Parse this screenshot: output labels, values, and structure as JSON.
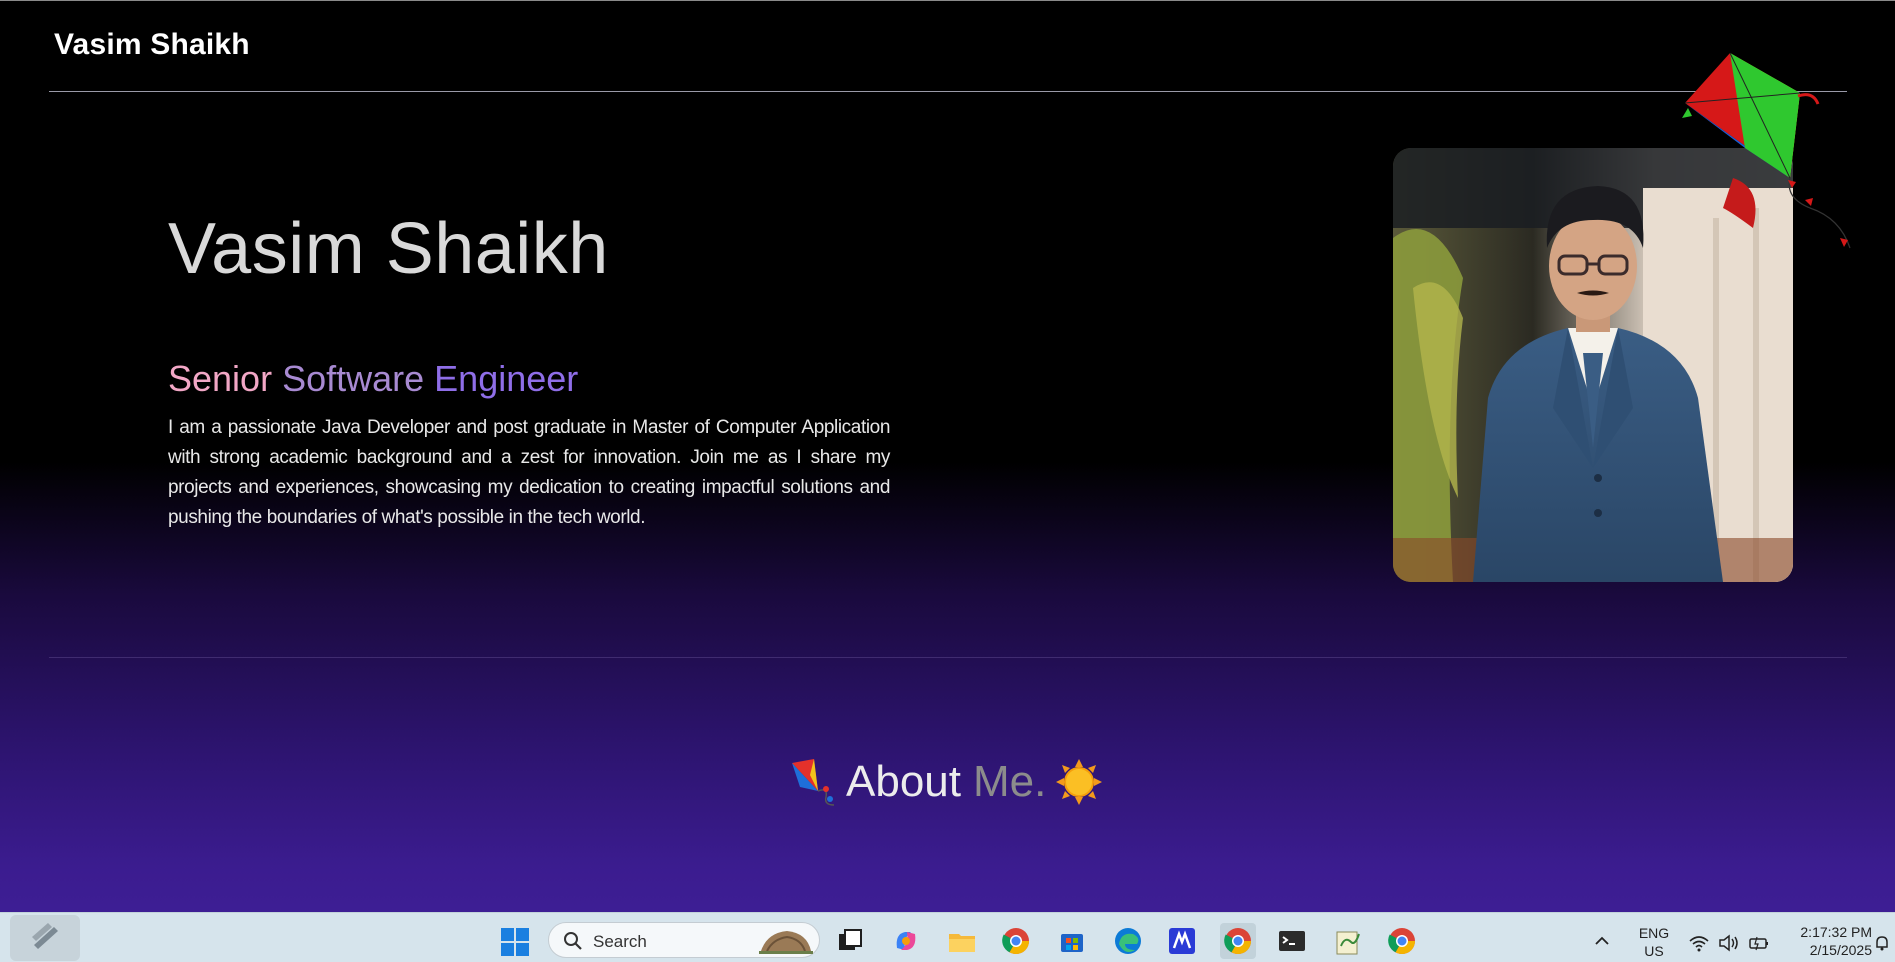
{
  "colors": {
    "background_top": "#000000",
    "background_bottom": "#40209a",
    "role_gradient": [
      "#f2a7c6",
      "#a88ad2",
      "#8f6ee8"
    ],
    "taskbar": "#d6e4ec"
  },
  "nav": {
    "brand": "Vasim Shaikh"
  },
  "hero": {
    "name": "Vasim Shaikh",
    "role_words": [
      "Senior",
      "Software",
      "Engineer"
    ],
    "description": "I am a passionate Java Developer and post graduate in Master of Computer Application with strong academic background and a zest for innovation. Join me as I share my projects and experiences, showcasing my dedication to creating impactful solutions and pushing the boundaries of what's possible in the tech world.",
    "photo_icon": "profile-photo",
    "decoration_icon": "kite-icon"
  },
  "about": {
    "heading_word1": "About",
    "heading_word2": "Me.",
    "left_icon": "kite-emoji-icon",
    "right_icon": "sun-emoji-icon"
  },
  "taskbar": {
    "search_label": "Search",
    "apps": [
      "task-view-icon",
      "copilot-icon",
      "file-explorer-icon",
      "chrome-icon",
      "store-icon",
      "edge-icon",
      "app-icon",
      "chrome-icon",
      "terminal-icon",
      "notepad-icon",
      "chrome-icon"
    ],
    "language_line1": "ENG",
    "language_line2": "US",
    "time": "2:17:32 PM",
    "date": "2/15/2025"
  }
}
